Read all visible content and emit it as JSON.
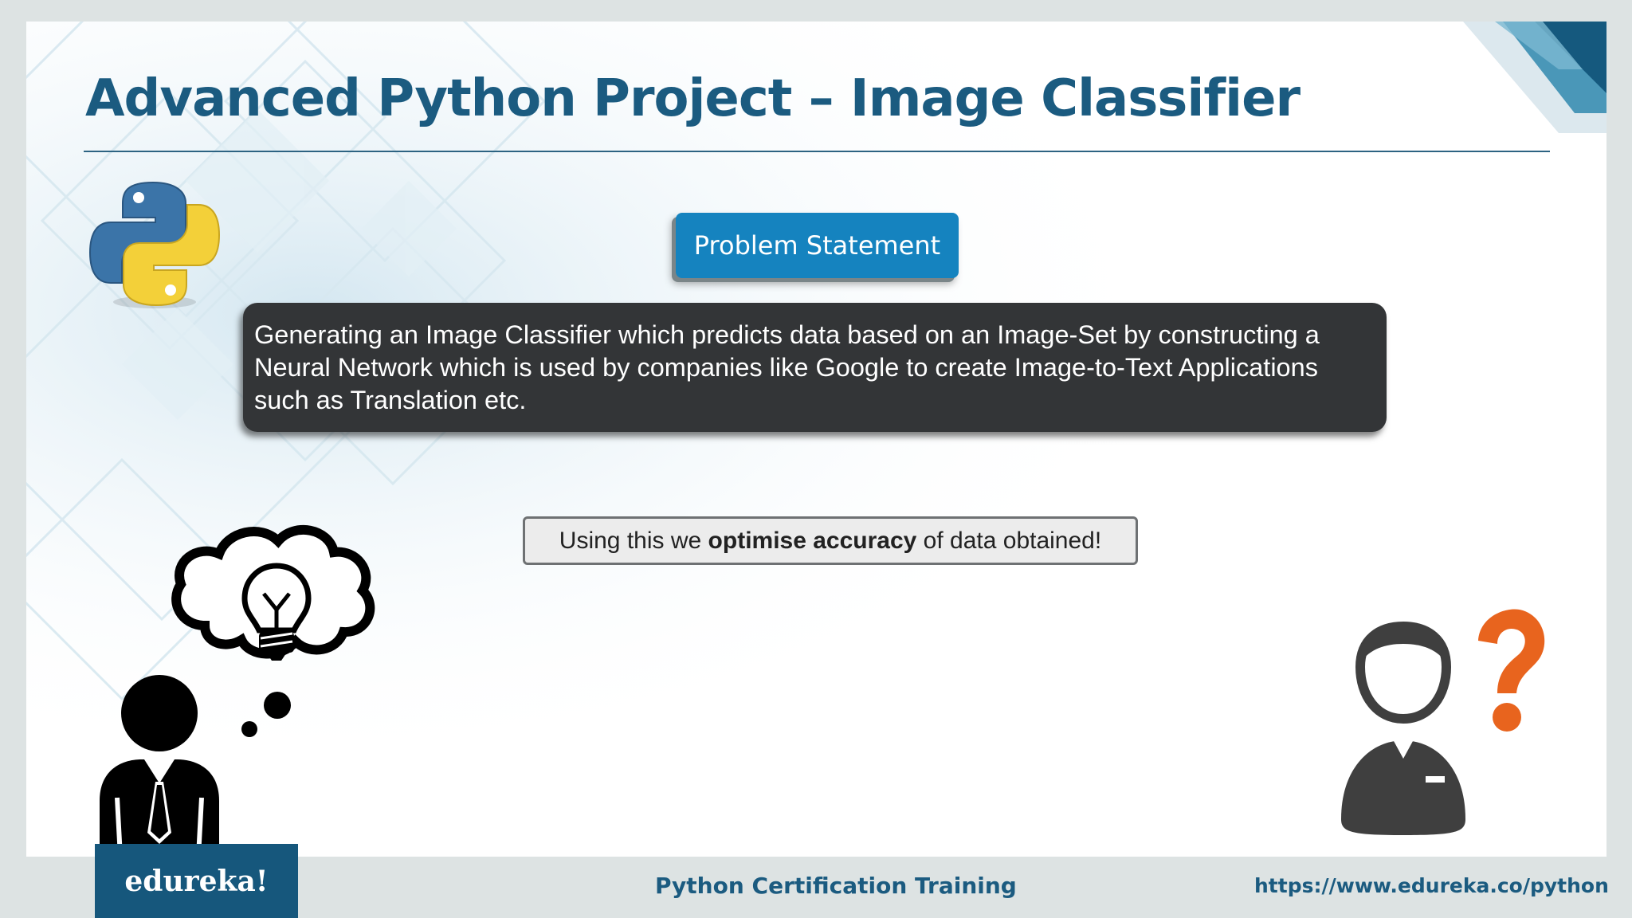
{
  "slide": {
    "title": "Advanced Python Project – Image Classifier",
    "problem_button": "Problem Statement",
    "statement_lines": [
      "Generating an Image Classifier which predicts data based on an Image-Set by constructing a",
      "Neural Network which is used by companies like Google to create Image-to-Text Applications",
      "such as Translation etc."
    ],
    "note": {
      "before": "Using this we ",
      "bold": "optimise accuracy",
      "after": " of data obtained!"
    }
  },
  "footer": {
    "brand": "edureka!",
    "course": "Python Certification Training",
    "url": "https://www.edureka.co/python"
  },
  "icons": {
    "logo": "python-logo",
    "thinker": "person-thinking-lightbulb-icon",
    "confused": "person-question-mark-icon",
    "question_mark_color": "#e8641e"
  },
  "colors": {
    "accent": "#1583bf",
    "title": "#1b5b80",
    "brand_bg": "#16577c",
    "statement_bg": "#333537"
  }
}
